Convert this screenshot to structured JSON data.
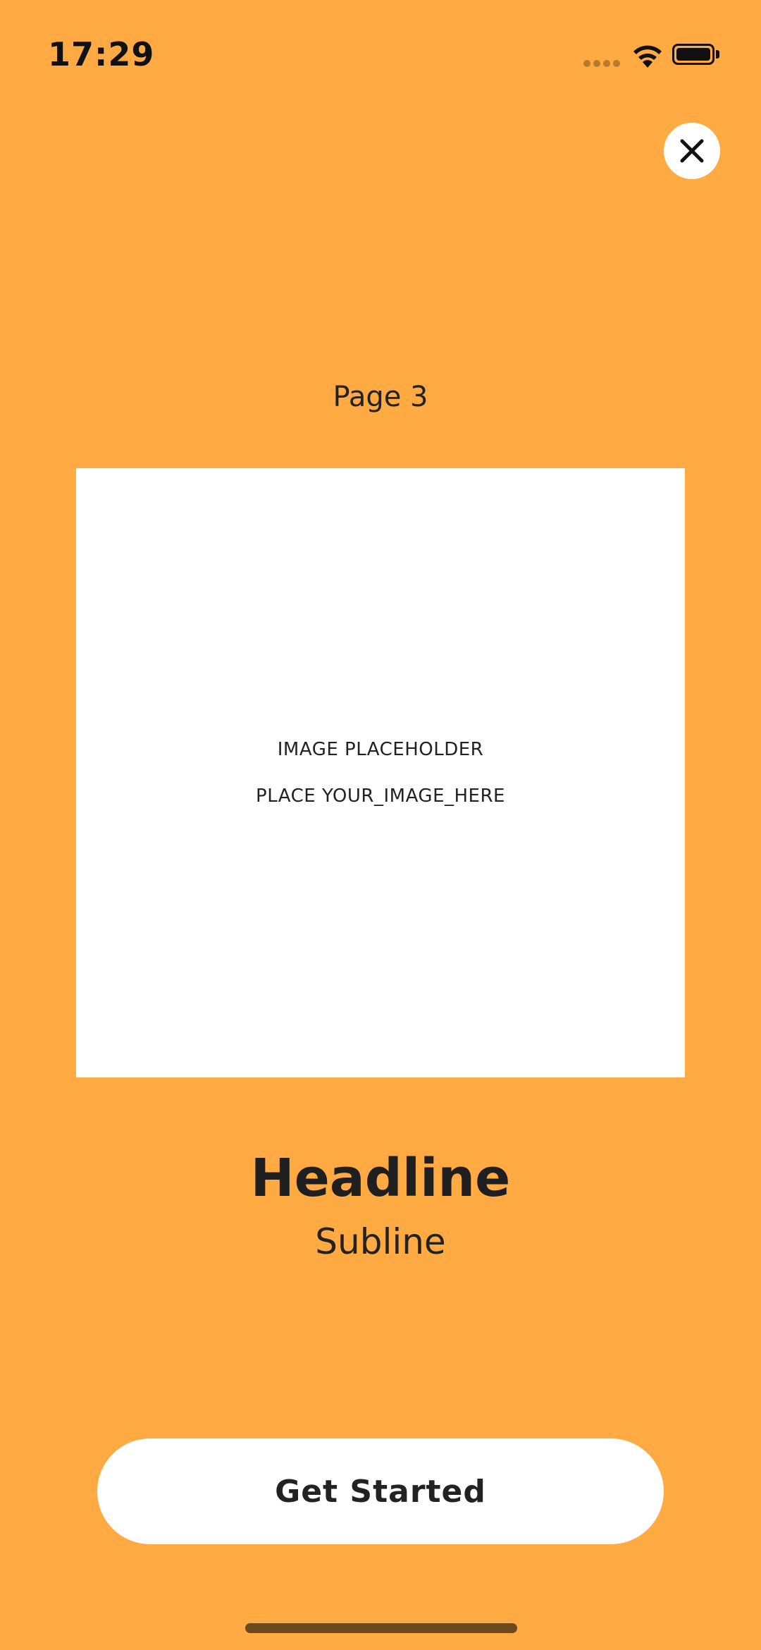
{
  "status_bar": {
    "time": "17:29",
    "icons": [
      "cellular-signal-icon",
      "wifi-icon",
      "battery-icon"
    ]
  },
  "close_button": {
    "icon": "close-icon"
  },
  "page_label": "Page 3",
  "image_placeholder": {
    "line1": "IMAGE PLACEHOLDER",
    "line2": "PLACE YOUR_IMAGE_HERE"
  },
  "headline": "Headline",
  "subline": "Subline",
  "cta_label": "Get Started",
  "colors": {
    "background": "#FFAA42",
    "surface": "#FFFFFF",
    "text": "#1F1F1F"
  }
}
